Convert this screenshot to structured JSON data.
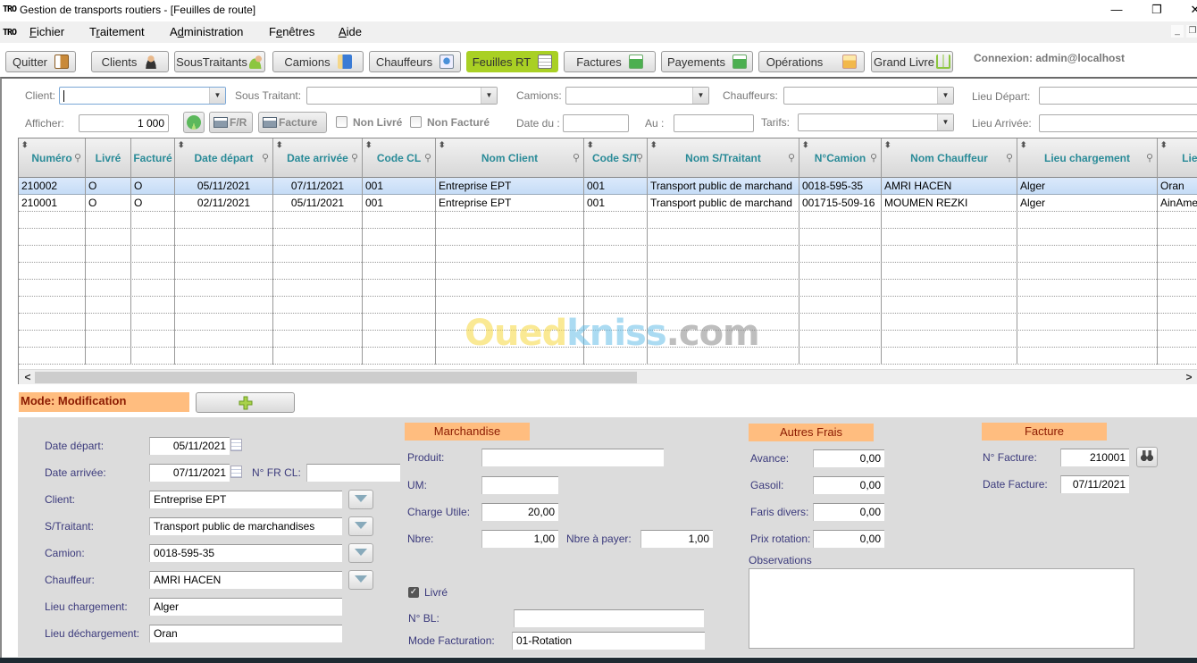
{
  "window": {
    "app_logo": "TRO",
    "title": "Gestion de transports routiers - [Feuilles de route]",
    "minimize_glyph": "—",
    "restore_glyph": "❐",
    "close_glyph": "✕"
  },
  "menu": {
    "logo": "TRO",
    "items": [
      {
        "label": "Fichier",
        "accel": "F"
      },
      {
        "label": "Traitement",
        "accel": "r"
      },
      {
        "label": "Administration",
        "accel": "d"
      },
      {
        "label": "Fenêtres",
        "accel": "e"
      },
      {
        "label": "Aide",
        "accel": "A"
      }
    ],
    "mdi_minimize": "_",
    "mdi_restore": "❐"
  },
  "toolbar": {
    "buttons": [
      {
        "label": "Quitter",
        "icon": "exit-door-icon"
      },
      {
        "label": "Clients",
        "icon": "person-icon"
      },
      {
        "label": "SousTraitants",
        "icon": "people-icon"
      },
      {
        "label": "Camions",
        "icon": "truck-icon"
      },
      {
        "label": "Chauffeurs",
        "icon": "driver-card-icon"
      },
      {
        "label": "Feuilles RT",
        "icon": "sheet-clock-icon",
        "active": true
      },
      {
        "label": "Factures",
        "icon": "money-icon"
      },
      {
        "label": "Payements",
        "icon": "money-icon"
      },
      {
        "label": "Opérations",
        "icon": "folder-icon"
      },
      {
        "label": "Grand Livre",
        "icon": "book-icon"
      }
    ],
    "connexion": "Connexion: admin@localhost",
    "active_color": "#a9d024"
  },
  "filters": {
    "client_label": "Client:",
    "client_value": "",
    "sous_traitant_label": "Sous Traitant:",
    "sous_traitant_value": "",
    "camions_label": "Camions:",
    "camions_value": "",
    "chauffeurs_label": "Chauffeurs:",
    "chauffeurs_value": "",
    "lieu_depart_label": "Lieu Départ:",
    "lieu_depart_value": "",
    "afficher_label": "Afficher:",
    "afficher_value": "1 000",
    "print_fr_label": "F/R",
    "print_facture_label": "Facture",
    "non_livre_label": "Non Livré",
    "non_livre_checked": false,
    "non_facture_label": "Non Facturé",
    "non_facture_checked": false,
    "date_du_label": "Date du :",
    "date_du_value": "",
    "au_label": "Au :",
    "au_value": "",
    "tarifs_label": "Tarifs:",
    "tarifs_value": "",
    "lieu_arrivee_label": "Lieu Arrivée:",
    "lieu_arrivee_value": ""
  },
  "grid": {
    "columns": [
      "Numéro",
      "Livré",
      "Facturé",
      "Date départ",
      "Date arrivée",
      "Code CL",
      "Nom Client",
      "Code S/T",
      "Nom S/Traitant",
      "N°Camion",
      "Nom Chauffeur",
      "Lieu chargement",
      "Lieu"
    ],
    "rows": [
      [
        "210002",
        "O",
        "O",
        "05/11/2021",
        "07/11/2021",
        "001",
        "Entreprise EPT",
        "001",
        "Transport public de marchand",
        "0018-595-35",
        "AMRI HACEN",
        "Alger",
        "Oran"
      ],
      [
        "210001",
        "O",
        "O",
        "02/11/2021",
        "05/11/2021",
        "001",
        "Entreprise EPT",
        "001",
        "Transport public de marchand",
        "001715-509-16",
        "MOUMEN REZKI",
        "Alger",
        "AinAme"
      ]
    ],
    "selected_row": 0,
    "header_color": "#2a8b98",
    "scroll_left": "<",
    "scroll_right": ">"
  },
  "watermark": {
    "part1": "Oued",
    "part2": "kniss",
    "part3": ".com"
  },
  "mode": {
    "label": "Mode: Modification",
    "add_icon": "plus-icon"
  },
  "detail": {
    "date_depart_label": "Date départ:",
    "date_depart": "05/11/2021",
    "date_arrivee_label": "Date arrivée:",
    "date_arrivee": "07/11/2021",
    "n_fr_cl_label": "N° FR CL:",
    "n_fr_cl": "",
    "client_label": "Client:",
    "client": "Entreprise EPT",
    "straitant_label": "S/Traitant:",
    "straitant": "Transport public de marchandises",
    "camion_label": "Camion:",
    "camion": "0018-595-35",
    "chauffeur_label": "Chauffeur:",
    "chauffeur": "AMRI HACEN",
    "lieu_chargement_label": "Lieu chargement:",
    "lieu_chargement": "Alger",
    "lieu_dechargement_label": "Lieu déchargement:",
    "lieu_dechargement": "Oran",
    "marchandise": {
      "title": "Marchandise",
      "produit_label": "Produit:",
      "produit": "",
      "um_label": "UM:",
      "um": "",
      "charge_utile_label": "Charge Utile:",
      "charge_utile": "20,00",
      "nbre_label": "Nbre:",
      "nbre": "1,00",
      "nbre_payer_label": "Nbre à payer:",
      "nbre_payer": "1,00",
      "livre_label": "Livré",
      "livre_checked": true,
      "n_bl_label": "N° BL:",
      "n_bl": "",
      "mode_facturation_label": "Mode Facturation:",
      "mode_facturation": "01-Rotation"
    },
    "autres_frais": {
      "title": "Autres Frais",
      "avance_label": "Avance:",
      "avance": "0,00",
      "gasoil_label": "Gasoil:",
      "gasoil": "0,00",
      "frais_divers_label": "Faris divers:",
      "frais_divers": "0,00",
      "prix_rotation_label": "Prix rotation:",
      "prix_rotation": "0,00",
      "observations_label": "Observations",
      "observations": ""
    },
    "facture": {
      "title": "Facture",
      "n_facture_label": "N° Facture:",
      "n_facture": "210001",
      "date_facture_label": "Date Facture:",
      "date_facture": "07/11/2021"
    }
  }
}
